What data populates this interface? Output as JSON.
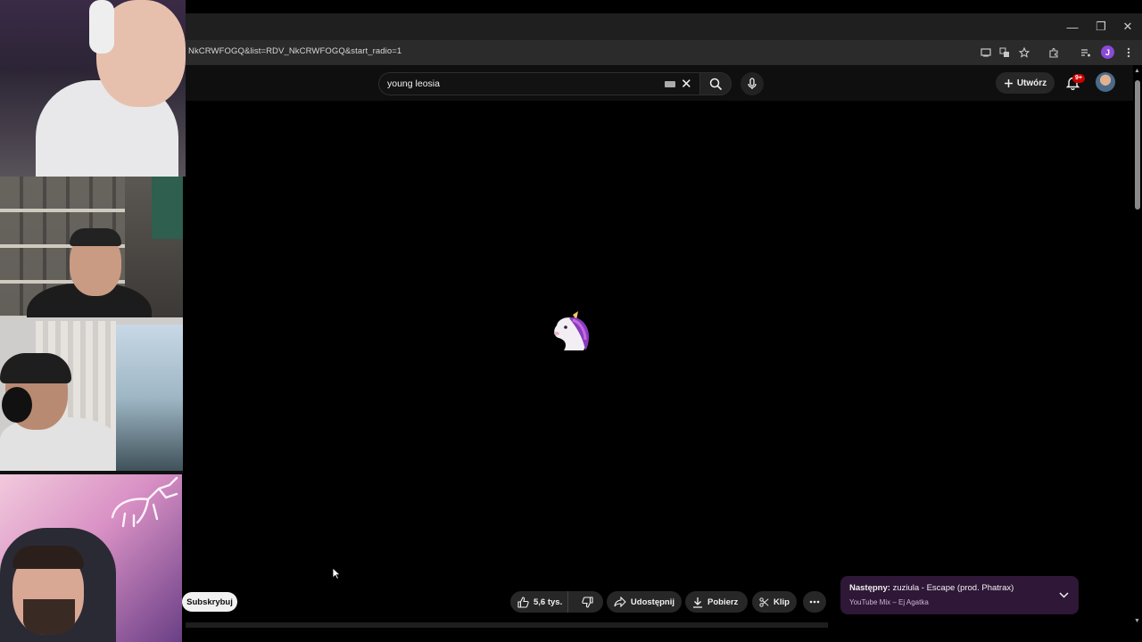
{
  "window": {
    "minimize_glyph": "—",
    "maximize_glyph": "❐",
    "close_glyph": "✕"
  },
  "browser": {
    "url": "NkCRWFOGQ&list=RDV_NkCRWFOGQ&start_radio=1",
    "profile_initial": "J",
    "icons": [
      "cast-icon",
      "translate-icon",
      "bookmark-star-icon",
      "extensions-icon",
      "media-controls-icon",
      "profile-avatar-icon",
      "kebab-menu-icon"
    ]
  },
  "youtube_header": {
    "search_value": "young leosia",
    "create_label": "Utwórz",
    "notifications_badge": "9+"
  },
  "actions": {
    "subscribe_label": "Subskrybuj",
    "like_count": "5,6 tys.",
    "share_label": "Udostępnij",
    "download_label": "Pobierz",
    "clip_label": "Klip"
  },
  "up_next": {
    "prefix": "Następny:",
    "title": "zuziula - Escape (prod. Phatrax)",
    "subtitle": "YouTube Mix – Ej Agatka"
  },
  "colors": {
    "accent_red": "#cc0000",
    "next_card_bg": "#2f1738",
    "profile_purple": "#8a4ad6"
  }
}
